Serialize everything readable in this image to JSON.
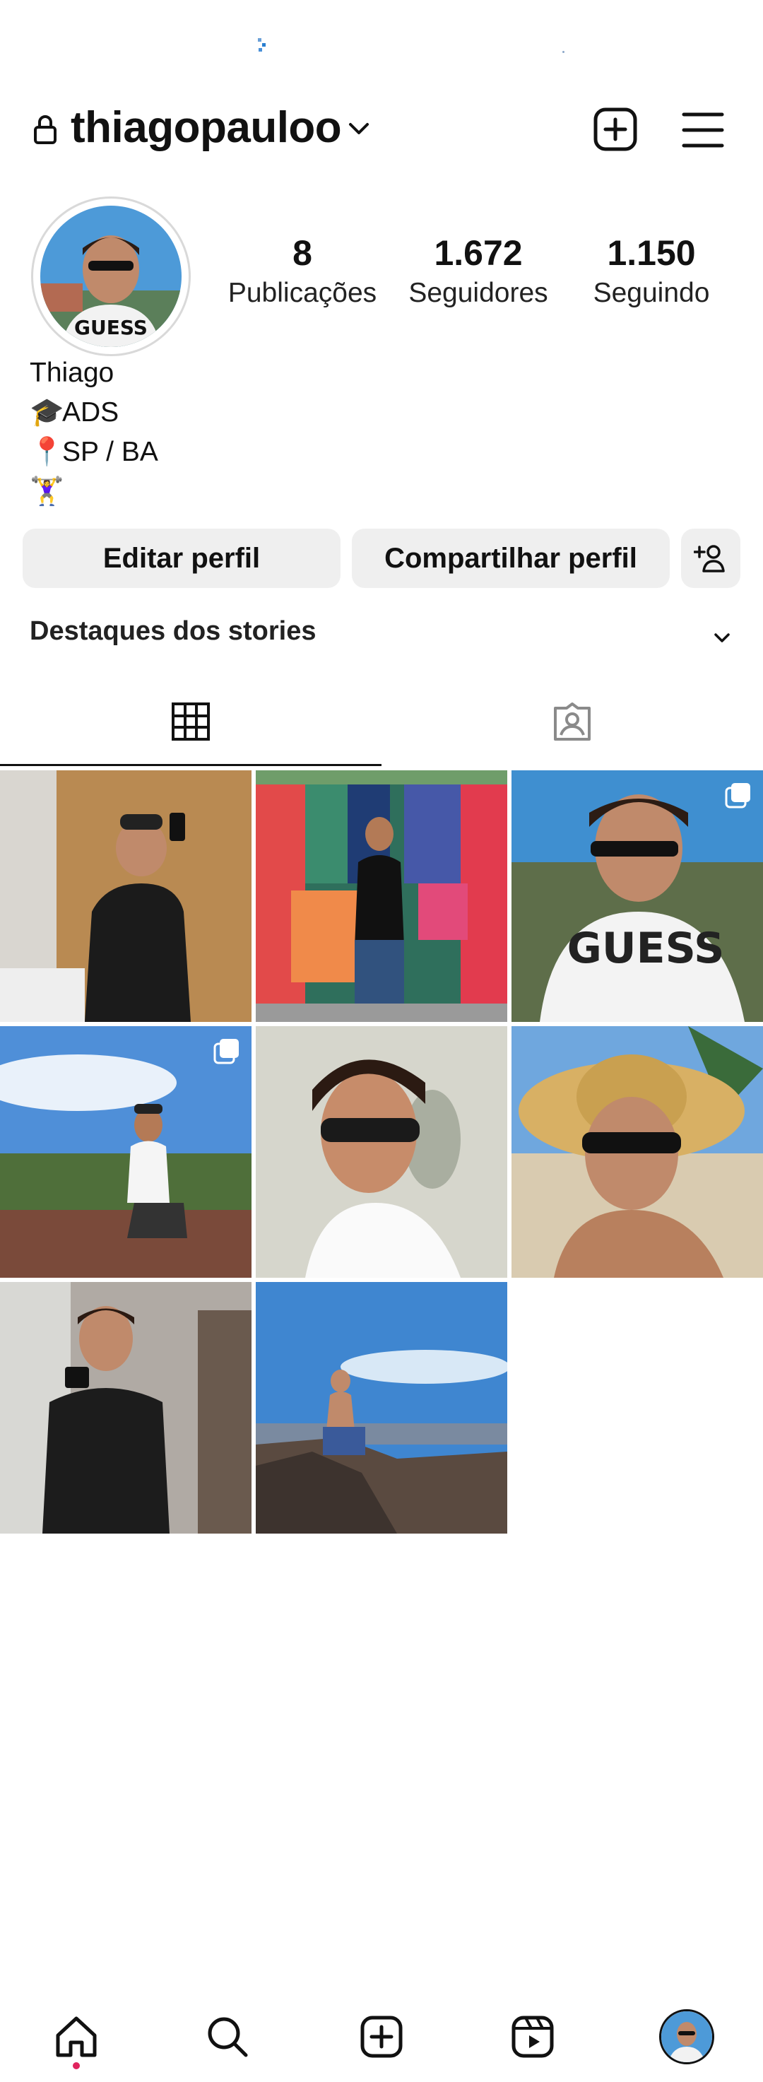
{
  "profile": {
    "username": "thiagopauloo",
    "name": "Thiago",
    "avatar_shirt_text": "GUESS"
  },
  "stats": [
    {
      "value": "8",
      "label": "Publicações"
    },
    {
      "value": "1.672",
      "label": "Seguidores"
    },
    {
      "value": "1.150",
      "label": "Seguindo"
    }
  ],
  "bio": {
    "line1_icon": "🎓",
    "line1_text": "ADS",
    "line2_icon": "📍",
    "line2_text": "SP / BA",
    "line3_icon": "🏋️‍♀️"
  },
  "buttons": {
    "edit_profile": "Editar perfil",
    "share_profile": "Compartilhar perfil"
  },
  "highlights": {
    "label": "Destaques dos stories"
  },
  "tabs": [
    {
      "icon": "grid-icon",
      "active": true
    },
    {
      "icon": "tagged-icon",
      "active": false
    }
  ],
  "posts": [
    {
      "kind": "mirror-selfie-tank-top",
      "multi": false
    },
    {
      "kind": "colorful-wall-sitting",
      "multi": false
    },
    {
      "kind": "guess-shirt-sunglasses",
      "multi": true
    },
    {
      "kind": "sky-rocks-crouching",
      "multi": true
    },
    {
      "kind": "sunglasses-closeup",
      "multi": false
    },
    {
      "kind": "straw-hat-beach",
      "multi": false
    },
    {
      "kind": "gym-mirror-selfie",
      "multi": false
    },
    {
      "kind": "mountain-rock-sky",
      "multi": false
    }
  ],
  "nav": [
    "home-icon",
    "search-icon",
    "create-icon",
    "reels-icon",
    "profile-avatar"
  ],
  "colors": {
    "accent": "#111111",
    "button_bg": "#efefef",
    "notification_dot": "#e0245e"
  }
}
